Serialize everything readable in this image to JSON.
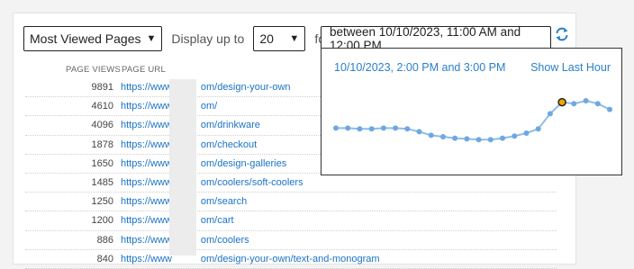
{
  "controls": {
    "report_select": "Most Viewed Pages",
    "display_label": "Display up to",
    "count_select": "20",
    "found_label": "found",
    "range_text": "between 10/10/2023, 11:00 AM and 12:00 PM"
  },
  "table": {
    "headers": {
      "views": "PAGE VIEWS",
      "url": "PAGE URL"
    },
    "rows": [
      {
        "views": "9891",
        "url_start": "https://www",
        "url_end": "om/design-your-own"
      },
      {
        "views": "4610",
        "url_start": "https://www",
        "url_end": "om/"
      },
      {
        "views": "4096",
        "url_start": "https://www",
        "url_end": "om/drinkware"
      },
      {
        "views": "1878",
        "url_start": "https://www",
        "url_end": "om/checkout"
      },
      {
        "views": "1650",
        "url_start": "https://www",
        "url_end": "om/design-galleries"
      },
      {
        "views": "1485",
        "url_start": "https://www",
        "url_end": "om/coolers/soft-coolers"
      },
      {
        "views": "1250",
        "url_start": "https://www",
        "url_end": "om/search"
      },
      {
        "views": "1200",
        "url_start": "https://www",
        "url_end": "om/cart"
      },
      {
        "views": "886",
        "url_start": "https://www",
        "url_end": "om/coolers"
      },
      {
        "views": "840",
        "url_start": "https://www",
        "url_end": "om/design-your-own/text-and-monogram"
      }
    ]
  },
  "popup": {
    "range_text": "10/10/2023, 2:00 PM and 3:00 PM",
    "show_last_hour": "Show Last Hour",
    "colors": {
      "line": "#8cbde8",
      "point": "#6fa8e0",
      "highlight_fill": "#f0a500",
      "highlight_stroke": "#222222"
    },
    "chart_data": {
      "type": "line",
      "values": [
        0.52,
        0.52,
        0.51,
        0.51,
        0.52,
        0.52,
        0.51,
        0.47,
        0.42,
        0.4,
        0.38,
        0.37,
        0.36,
        0.36,
        0.38,
        0.41,
        0.45,
        0.51,
        0.72,
        0.88,
        0.86,
        0.9,
        0.86,
        0.78
      ],
      "highlight_index": 19
    }
  },
  "icons": {
    "refresh": "refresh-icon",
    "dropdown": "chevron-down-icon"
  }
}
